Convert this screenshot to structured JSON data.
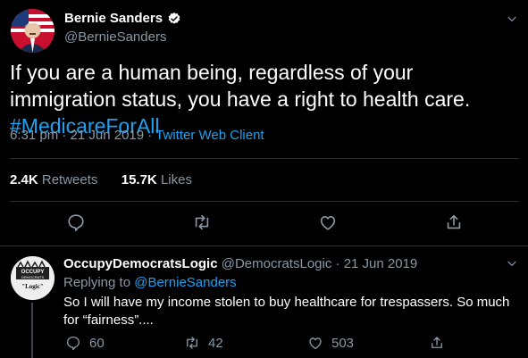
{
  "tweet": {
    "author_name": "Bernie Sanders",
    "author_handle": "@BernieSanders",
    "text": "If you are a human being, regardless of your immigration status, you have a right to health care.",
    "hashtag": "#MedicareForAll",
    "time": "6:31 pm · 21 Jun 2019 · ",
    "client": "Twitter Web Client",
    "retweets_count": "2.4K",
    "retweets_label": "Retweets",
    "likes_count": "15.7K",
    "likes_label": "Likes"
  },
  "reply": {
    "author_name": "OccupyDemocratsLogic",
    "author_handle": "@DemocratsLogic",
    "date": "21 Jun 2019",
    "separator": " · ",
    "replying_prefix": "Replying to ",
    "replying_to": "@BernieSanders",
    "text": "So I will have my income stolen to buy healthcare for trespassers. So much for “fairness”....",
    "reply_count": "60",
    "retweet_count": "42",
    "like_count": "503",
    "avatar_line1": "OCCUPY",
    "avatar_line2": "DEMOCRATS",
    "avatar_line3": "\"Logic\""
  },
  "colors": {
    "background": "#000000",
    "accent": "#1da1f2",
    "muted": "#8899a6",
    "divider": "#2f3336"
  },
  "icons": {
    "verified": "verified-badge-icon",
    "menu": "chevron-down-icon",
    "reply": "speech-bubble-icon",
    "retweet": "retweet-arrows-icon",
    "like": "heart-icon",
    "share": "share-upload-icon"
  }
}
